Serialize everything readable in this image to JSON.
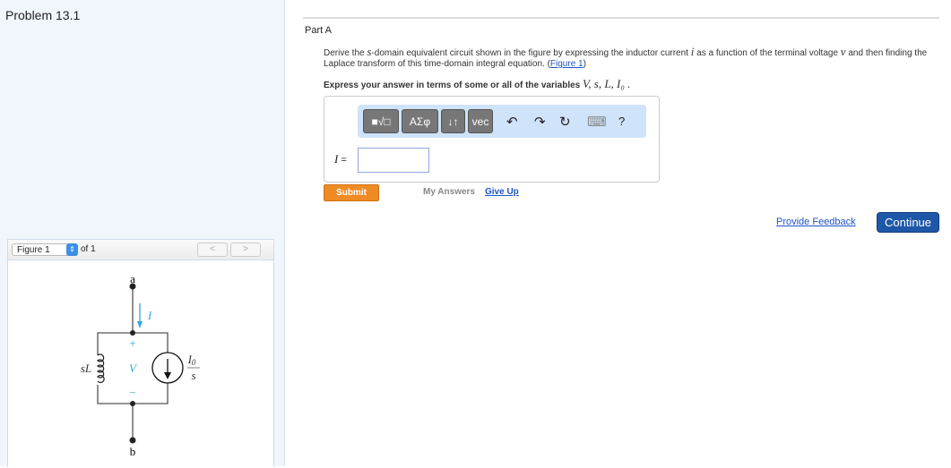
{
  "problem_title": "Problem 13.1",
  "figure": {
    "select_value": "Figure 1",
    "of_label": "of 1",
    "prev": "<",
    "next": ">",
    "labels": {
      "a": "a",
      "b": "b",
      "I": "I",
      "sL": "sL",
      "V": "V",
      "plus": "+",
      "minus": "−",
      "I0": "I",
      "I0_sub": "0",
      "s": "s"
    }
  },
  "part": {
    "title": "Part A",
    "desc_1": "Derive the ",
    "desc_s": "s",
    "desc_2": "-domain equivalent circuit shown in the figure by expressing the inductor current ",
    "desc_i": "i",
    "desc_3": " as a function of the terminal voltage ",
    "desc_v": "v",
    "desc_4": " and then finding the Laplace transform of this time-domain integral equation. (",
    "figure_link": "Figure 1",
    "desc_5": ")",
    "express": "Express your answer in terms of some or all of the variables ",
    "variables": "V, s, L, I₀ ."
  },
  "toolbar": {
    "template": "■√□",
    "greek": "ΑΣφ",
    "arrows": "↓↑",
    "vec": "vec",
    "undo": "↶",
    "redo": "↷",
    "reset": "↻",
    "keyboard": "⌨",
    "help": "?"
  },
  "answer": {
    "label": "I",
    "equals": " =",
    "value": ""
  },
  "actions": {
    "submit": "Submit",
    "my_answers": "My Answers",
    "give_up": "Give Up",
    "feedback": "Provide Feedback",
    "continue": "Continue"
  }
}
